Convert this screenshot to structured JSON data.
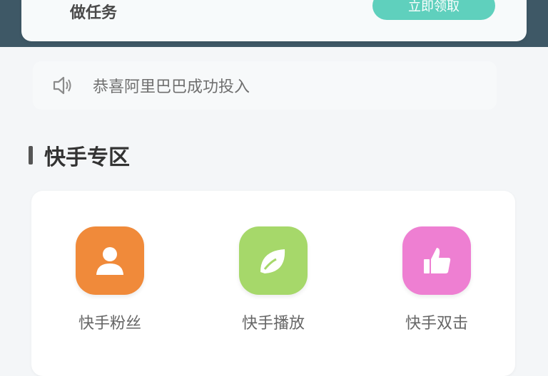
{
  "header": {
    "label": "做任务",
    "button_label": "立即领取"
  },
  "notice": {
    "icon": "speaker-icon",
    "text": "恭喜阿里巴巴成功投入"
  },
  "section": {
    "title": "快手专区"
  },
  "quick_items": [
    {
      "label": "快手粉丝",
      "icon": "user-icon",
      "color": "#f08a3a"
    },
    {
      "label": "快手播放",
      "icon": "leaf-icon",
      "color": "#a6d86a"
    },
    {
      "label": "快手双击",
      "icon": "thumbs-up-icon",
      "color": "#ee7fd2"
    }
  ]
}
